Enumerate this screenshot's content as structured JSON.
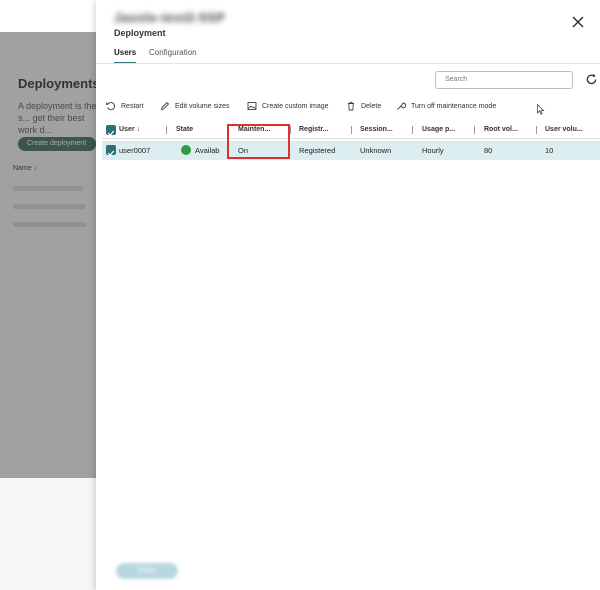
{
  "background": {
    "page_title": "Deployments",
    "description": "A deployment is the s... get their best work d...",
    "create_button": "Create deployment",
    "name_column": "Name ↓"
  },
  "panel": {
    "title": "Jassle-test2-5SP",
    "subtitle": "Deployment",
    "tabs": [
      {
        "label": "Users",
        "active": true
      },
      {
        "label": "Configuration",
        "active": false
      }
    ],
    "search": {
      "placeholder": "Search",
      "value": ""
    },
    "toolbar": {
      "restart": "Restart",
      "edit_volume": "Edit volume sizes",
      "create_image": "Create custom image",
      "delete": "Delete",
      "maintenance": "Turn off maintenance mode"
    },
    "table": {
      "columns": [
        "User",
        "State",
        "Mainten...",
        "Registr...",
        "Session...",
        "Usage p...",
        "Root vol...",
        "User volu..."
      ],
      "sort_indicator": "↓",
      "rows": [
        {
          "user": "user0007",
          "state": "Availab",
          "maintenance": "On",
          "registration": "Registered",
          "session": "Unknown",
          "usage_plan": "Hourly",
          "root_volume": "80",
          "user_volume": "10"
        }
      ]
    },
    "footer_button": "Close"
  },
  "colors": {
    "accent": "#2f6f78",
    "selected_row": "#dceef0",
    "highlight": "#e03131",
    "state_available": "#2e9b4a"
  }
}
